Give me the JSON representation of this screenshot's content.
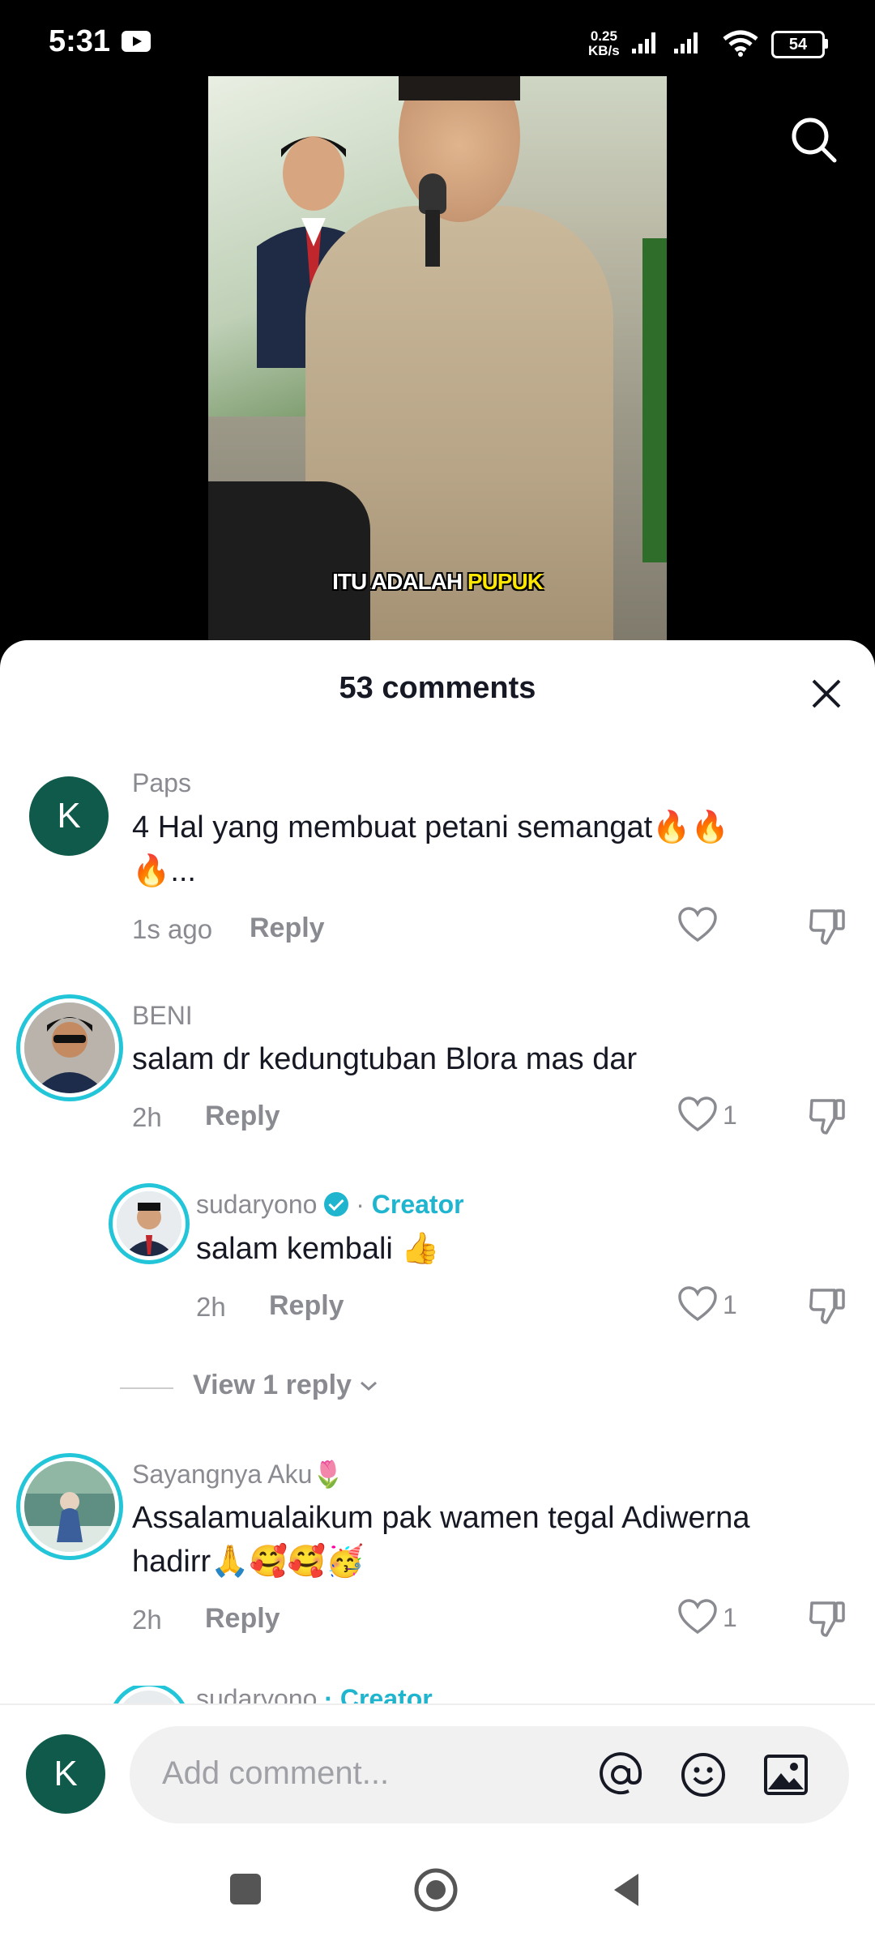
{
  "status_bar": {
    "time": "5:31",
    "net_speed": "0.25",
    "net_unit": "KB/s",
    "battery": "54"
  },
  "video": {
    "caption_part1": "ITU ADALAH ",
    "caption_part2": "PUPUK"
  },
  "comments_sheet": {
    "title": "53 comments",
    "comments": [
      {
        "avatar_letter": "K",
        "username": "Paps",
        "text_line1": "4 Hal yang membuat petani semangat🔥🔥",
        "text_line2": "🔥...",
        "time": "1s ago",
        "reply_label": "Reply"
      },
      {
        "username": "BENI",
        "text_line1": "salam dr kedungtuban Blora mas dar",
        "time": "2h",
        "reply_label": "Reply",
        "likes": "1"
      },
      {
        "username": "sudaryono",
        "creator_label": "Creator",
        "separator": "·",
        "text_line1": "salam kembali 👍",
        "time": "2h",
        "reply_label": "Reply",
        "likes": "1"
      },
      {
        "username": "Sayangnya Aku🌷",
        "text_line1": "Assalamualaikum pak wamen tegal Adiwerna",
        "text_line2": "hadirr🙏🥰🥰🥳",
        "time": "2h",
        "reply_label": "Reply",
        "likes": "1"
      }
    ],
    "view_replies": "View 1 reply",
    "partial_username": "sudaryono",
    "partial_creator": "· Creator"
  },
  "input_bar": {
    "avatar_letter": "K",
    "placeholder": "Add comment..."
  },
  "colors": {
    "accent": "#20b5cf",
    "avatar_bg": "#0f5a4a"
  }
}
